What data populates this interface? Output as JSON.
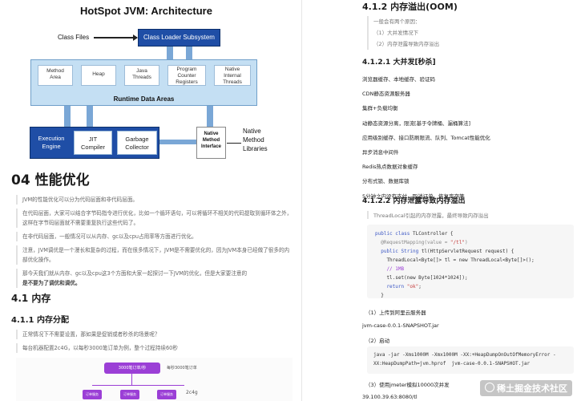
{
  "diagram": {
    "title": "HotSpot JVM: Architecture",
    "class_files": "Class Files",
    "class_loader": "Class Loader Subsystem",
    "runtime_cells": [
      {
        "l1": "Method",
        "l2": "Area"
      },
      {
        "l1": "Heap",
        "l2": ""
      },
      {
        "l1": "Java",
        "l2": "Threads"
      },
      {
        "l1": "Program",
        "l2": "Counter",
        "l3": "Registers"
      },
      {
        "l1": "Native",
        "l2": "Internal",
        "l3": "Threads"
      }
    ],
    "runtime_label": "Runtime Data Areas",
    "execution_engine": {
      "l1": "Execution",
      "l2": "Engine"
    },
    "jit": {
      "l1": "JIT",
      "l2": "Compiler"
    },
    "gc": {
      "l1": "Garbage",
      "l2": "Collector"
    },
    "native_interface": {
      "l1": "Native",
      "l2": "Method",
      "l3": "Interface"
    },
    "native_libraries": {
      "l1": "Native",
      "l2": "Method",
      "l3": "Libraries"
    }
  },
  "left": {
    "h1": "04 性能优化",
    "para1": "JVM的性能优化可以分为代码层面和非代码层面。",
    "para2": "在代码层面，大家可以结合字节码指令进行优化，比如一个循环语句，可以将循环不相关的代码提取到循环体之外，这样在字节码层面就不需要重复执行这些代码了。",
    "para3": "在非代码层面，一般情况可以从内存、gc以及cpu占用率等方面进行优化。",
    "para4": "注意，JVM调优是一个漫长和复杂的过程，而在很多情况下，JVM是不需要优化的，因为JVM本身已经做了很多的内部优化操作。",
    "para5a": "那今天我们就从内存、gc以及cpu这3个方面和大家一起探讨一下JVM的优化，但是大家要注意的",
    "para5b": "是不要为了调优和调优。",
    "h2": "4.1 内存",
    "h3": "4.1.1 内存分配",
    "para6": "正常情况下不需要设置，那如果是促销或者秒杀的场景呢？",
    "para7": "每台机器配置2c4G，以每秒3000笔订单为例，整个过程持续60秒",
    "mini": {
      "top": "3000笔订单/秒",
      "note": "每秒3000笔订单",
      "bottom_label": "订单服务",
      "side": "2c4g"
    }
  },
  "right": {
    "h2": "4.1.2 内存溢出(OOM)",
    "intro": [
      "一般会有两个原因：",
      "（1）大并发情况下",
      "（2）内存泄露导致内存溢出"
    ],
    "h4_1": "4.1.2.1 大并发[秒杀]",
    "list": [
      "浏览器缓存、本地缓存、验证码",
      "CDN静态资源服务器",
      "集群+负载均衡",
      "动静态资源分离，限流[基于令牌桶、漏桶算法]",
      "应用级别缓存、接口防刷限流、队列、Tomcat性能优化",
      "异步消息中间件",
      "Redis热点数据对象缓存",
      "分布式锁、数据库锁",
      "5分钟之内没有支付，取消订单、恢复库存等"
    ],
    "h4_2": "4.1.2.2 内存泄露导致内存溢出",
    "quote": "ThreadLocal引起的内存泄露，最终导致内存溢出",
    "code": {
      "l1_kw": "public class",
      "l1_rest": " TLController {",
      "l2_an": "  @RequestMapping(value = ",
      "l2_st": "\"/tl\"",
      "l2_end": ")",
      "l3_kw": "  public ",
      "l3_ty": "String",
      "l3_rest": " tl(HttpServletRequest request) {",
      "l4": "    ThreadLocal<Byte[]> tl = new ThreadLocal<Byte[]>();",
      "l5": "    // 1MB",
      "l6": "    tl.set(new Byte[1024*1024]);",
      "l7_kw": "    return ",
      "l7_st": "\"ok\"",
      "l7_end": ";",
      "l8": "  }",
      "l9": "}"
    },
    "step1": "（1）上传到阿里云服务器",
    "jar": "jvm-case-0.0.1-SNAPSHOT.jar",
    "step2": "（2）启动",
    "cmd1": "java -jar -Xms1000M -Xmx1000M -XX:+HeapDumpOnOutOfMemoryError -",
    "cmd2": "XX:HeapDumpPath=jvm.hprof  jvm-case-0.0.1-SNAPSHOT.jar",
    "step3": "（3）使用jmeter模拟10000次并发",
    "addr": "39.100.39.63:8080/tl",
    "watermark": "稀土掘金技术社区"
  }
}
